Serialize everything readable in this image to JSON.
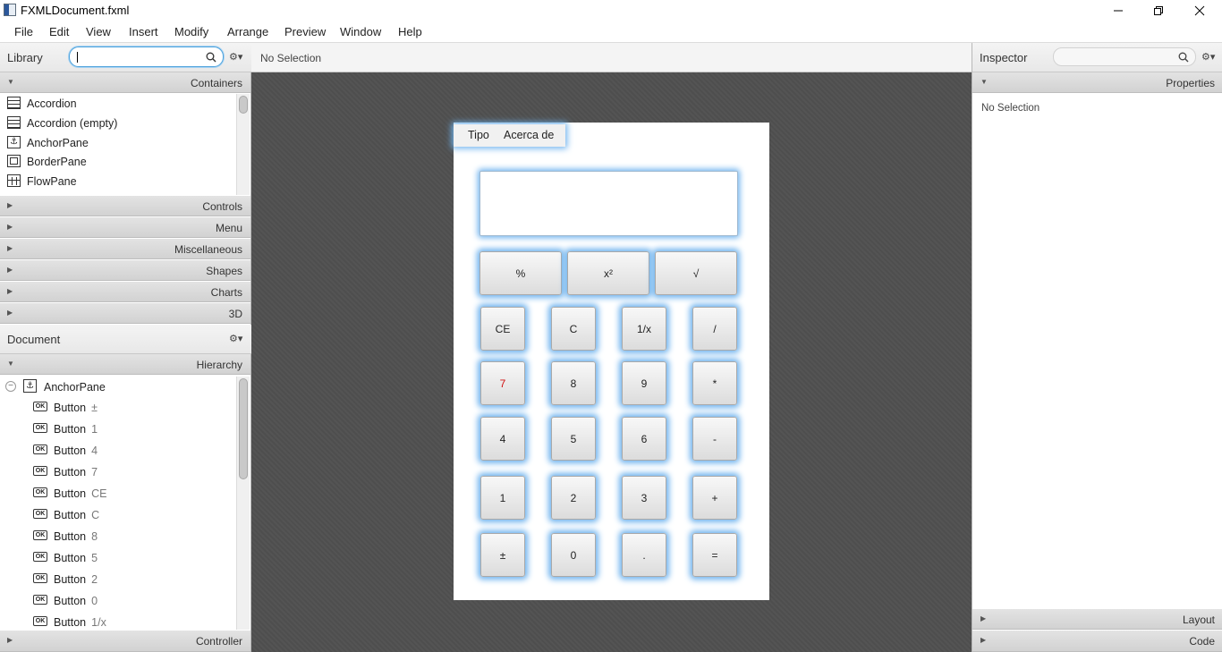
{
  "window": {
    "title": "FXMLDocument.fxml"
  },
  "menubar": {
    "items": [
      "File",
      "Edit",
      "View",
      "Insert",
      "Modify",
      "Arrange",
      "Preview",
      "Window",
      "Help"
    ]
  },
  "library": {
    "title": "Library",
    "search": {
      "value": ""
    },
    "sections": [
      "Containers",
      "Controls",
      "Menu",
      "Miscellaneous",
      "Shapes",
      "Charts",
      "3D"
    ],
    "containers": [
      "Accordion",
      "Accordion  (empty)",
      "AnchorPane",
      "BorderPane",
      "FlowPane"
    ]
  },
  "document": {
    "title": "Document",
    "hierarchy_label": "Hierarchy",
    "root": "AnchorPane",
    "items": [
      {
        "type": "Button",
        "text": "±"
      },
      {
        "type": "Button",
        "text": "1"
      },
      {
        "type": "Button",
        "text": "4"
      },
      {
        "type": "Button",
        "text": "7"
      },
      {
        "type": "Button",
        "text": "CE"
      },
      {
        "type": "Button",
        "text": "C"
      },
      {
        "type": "Button",
        "text": "8"
      },
      {
        "type": "Button",
        "text": "5"
      },
      {
        "type": "Button",
        "text": "2"
      },
      {
        "type": "Button",
        "text": "0"
      },
      {
        "type": "Button",
        "text": "1/x"
      }
    ],
    "ok_icon_label": "OK",
    "controller_label": "Controller"
  },
  "center": {
    "selection_status": "No Selection"
  },
  "calculator": {
    "menu": [
      "Tipo",
      "Acerca de"
    ],
    "display_value": "",
    "top_row": [
      "%",
      "x²",
      "√"
    ],
    "rows": [
      [
        "CE",
        "C",
        "1/x",
        "/"
      ],
      [
        "7",
        "8",
        "9",
        "*"
      ],
      [
        "4",
        "5",
        "6",
        "-"
      ],
      [
        "1",
        "2",
        "3",
        "+"
      ],
      [
        "±",
        "0",
        ".",
        "="
      ]
    ],
    "highlight_color": "#6fb3ee",
    "seven_color": "#d01010"
  },
  "inspector": {
    "title": "Inspector",
    "properties_label": "Properties",
    "status": "No Selection",
    "layout_label": "Layout",
    "code_label": "Code"
  }
}
